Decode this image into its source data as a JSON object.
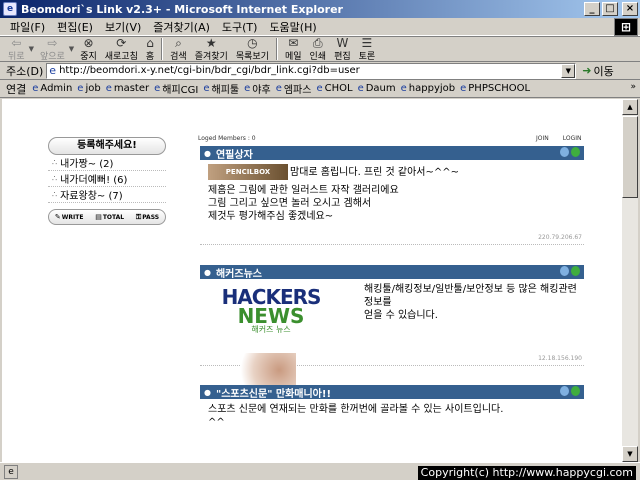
{
  "window": {
    "title": "Beomdori`s Link v2.3+ - Microsoft Internet Explorer",
    "minimize": "_",
    "maximize": "□",
    "close": "×"
  },
  "menu": [
    "파일(F)",
    "편집(E)",
    "보기(V)",
    "즐겨찾기(A)",
    "도구(T)",
    "도움말(H)"
  ],
  "toolbar": {
    "back": "뒤로",
    "forward": "앞으로",
    "stop": "중지",
    "refresh": "새로고침",
    "home": "홈",
    "search": "검색",
    "favorites": "즐겨찾기",
    "history": "목록보기",
    "mail": "메일",
    "print": "인쇄",
    "edit": "편집",
    "discuss": "토론"
  },
  "address": {
    "label": "주소(D)",
    "url": "http://beomdori.x-y.net/cgi-bin/bdr_cgi/bdr_link.cgi?db=user",
    "go": "이동"
  },
  "links": {
    "label": "연결",
    "items": [
      "Admin",
      "job",
      "master",
      "해피CGI",
      "해피툴",
      "야후",
      "엠파스",
      "CHOL",
      "Daum",
      "happyjob",
      "PHPSCHOOL"
    ]
  },
  "left_box": {
    "title": "등록해주세요!",
    "rows": [
      "내가짱~ (2)",
      "내가더예뻐! (6)",
      "자료왕창~ (7)"
    ],
    "footer": [
      "WRITE",
      "TOTAL",
      "PASS"
    ]
  },
  "members_text": "Loged Members : 0",
  "join_links": [
    "JOIN",
    "LOGIN"
  ],
  "sections": [
    {
      "title": "연필상자",
      "logo": "PENCILBOX",
      "lines": [
        "맘대로 홈립니다. 프린 것 같아서~^^~",
        "제홈은 그림에 관한 일러스트 자작 갤러리에요",
        "그림 그리고 싶으면 놀러 오시고 겜해서",
        "제것두 평가해주심 좋겠네요~"
      ],
      "ip": "220.79.206.67"
    },
    {
      "title": "해커즈뉴스",
      "logo": [
        "HACKERS",
        "NEWS",
        "해커즈 뉴스"
      ],
      "lines": [
        "해킹툴/해킹정보/일반툴/보안정보 등 많은 해킹관련정보를",
        "얻을 수 있습니다."
      ],
      "ip": "12.18.156.190"
    },
    {
      "title": "\"스포츠신문\" 만화매니아!!",
      "lines": [
        "스포츠 신문에 연재되는 만화를 한꺼번에 골라볼 수 있는 사이트입니다.",
        "^^"
      ]
    }
  ],
  "status": {
    "copyright": "Copyright(c) http://www.happycgi.com"
  }
}
